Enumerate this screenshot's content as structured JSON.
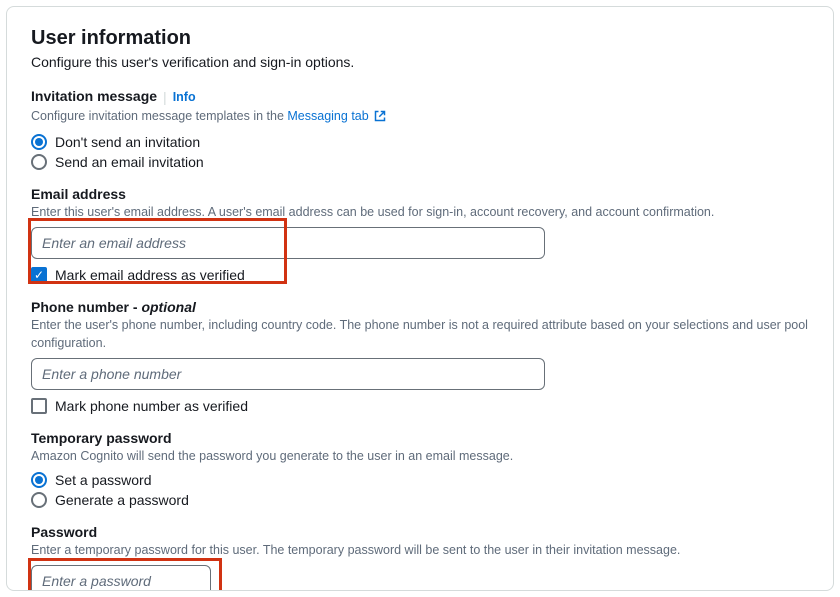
{
  "header": {
    "title": "User information",
    "subtitle": "Configure this user's verification and sign-in options."
  },
  "invitation": {
    "label": "Invitation message",
    "info": "Info",
    "helper_prefix": "Configure invitation message templates in the ",
    "helper_link": "Messaging tab",
    "options": {
      "dont_send": "Don't send an invitation",
      "email": "Send an email invitation"
    }
  },
  "email": {
    "label": "Email address",
    "helper": "Enter this user's email address. A user's email address can be used for sign-in, account recovery, and account confirmation.",
    "placeholder": "Enter an email address",
    "verify_label": "Mark email address as verified"
  },
  "phone": {
    "label_prefix": "Phone number - ",
    "label_optional": "optional",
    "helper": "Enter the user's phone number, including country code. The phone number is not a required attribute based on your selections and user pool configuration.",
    "placeholder": "Enter a phone number",
    "verify_label": "Mark phone number as verified"
  },
  "temp_password": {
    "label": "Temporary password",
    "helper": "Amazon Cognito will send the password you generate to the user in an email message.",
    "options": {
      "set": "Set a password",
      "generate": "Generate a password"
    }
  },
  "password": {
    "label": "Password",
    "helper": "Enter a temporary password for this user. The temporary password will be sent to the user in their invitation message.",
    "placeholder": "Enter a password"
  }
}
